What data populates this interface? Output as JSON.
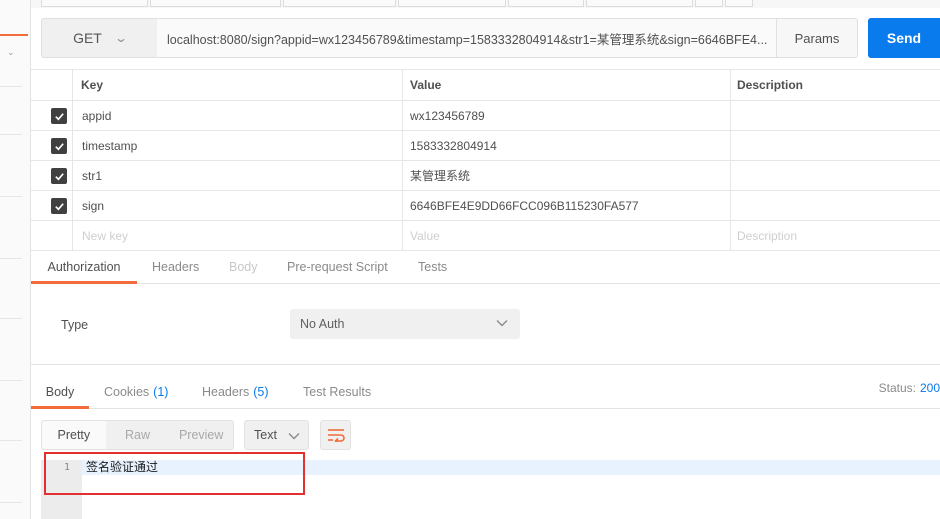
{
  "request": {
    "method": "GET",
    "url": "localhost:8080/sign?appid=wx123456789&timestamp=1583332804914&str1=某管理系统&sign=6646BFE4...",
    "params_label": "Params",
    "send_label": "Send"
  },
  "params_table": {
    "headers": {
      "key": "Key",
      "value": "Value",
      "description": "Description"
    },
    "rows": [
      {
        "checked": true,
        "key": "appid",
        "value": "wx123456789",
        "description": ""
      },
      {
        "checked": true,
        "key": "timestamp",
        "value": "1583332804914",
        "description": ""
      },
      {
        "checked": true,
        "key": "str1",
        "value": "某管理系统",
        "description": ""
      },
      {
        "checked": true,
        "key": "sign",
        "value": "6646BFE4E9DD66FCC096B115230FA577",
        "description": ""
      }
    ],
    "new_row": {
      "key_placeholder": "New key",
      "value_placeholder": "Value",
      "description_placeholder": "Description"
    }
  },
  "request_tabs": {
    "authorization": "Authorization",
    "headers": "Headers",
    "body": "Body",
    "prerequest": "Pre-request Script",
    "tests": "Tests"
  },
  "auth": {
    "type_label": "Type",
    "type_value": "No Auth"
  },
  "response_tabs": {
    "body": "Body",
    "cookies": "Cookies",
    "cookies_count": "(1)",
    "headers": "Headers",
    "headers_count": "(5)",
    "test_results": "Test Results",
    "status_label": "Status:",
    "status_value": "200"
  },
  "response_toolbar": {
    "pretty": "Pretty",
    "raw": "Raw",
    "preview": "Preview",
    "format": "Text"
  },
  "response_body": {
    "line_number": "1",
    "text": "签名验证通过"
  },
  "colors": {
    "accent_orange": "#f26b3a",
    "send_blue": "#097bed",
    "highlight_red": "#e0302f"
  }
}
